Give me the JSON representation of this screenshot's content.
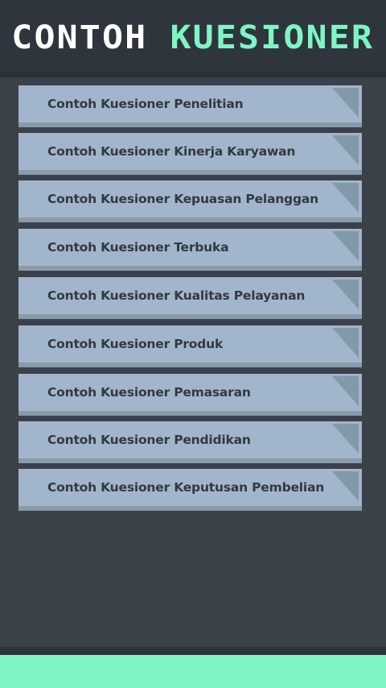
{
  "header": {
    "title_part1": "CONTOH",
    "title_part2": "KUESIONER"
  },
  "menu": {
    "items": [
      {
        "label": "Contoh Kuesioner Penelitian"
      },
      {
        "label": "Contoh Kuesioner Kinerja Karyawan"
      },
      {
        "label": "Contoh Kuesioner Kepuasan Pelanggan"
      },
      {
        "label": "Contoh Kuesioner Terbuka"
      },
      {
        "label": "Contoh Kuesioner Kualitas Pelayanan"
      },
      {
        "label": "Contoh Kuesioner Produk"
      },
      {
        "label": "Contoh Kuesioner Pemasaran"
      },
      {
        "label": "Contoh Kuesioner Pendidikan"
      },
      {
        "label": "Contoh Kuesioner Keputusan Pembelian"
      }
    ]
  },
  "colors": {
    "background": "#3a4149",
    "header": "#2f353d",
    "accent": "#7ff5c4",
    "item": "#a1b6cc",
    "item_shadow": "#8a9aa8",
    "corner": "#8299a8"
  }
}
